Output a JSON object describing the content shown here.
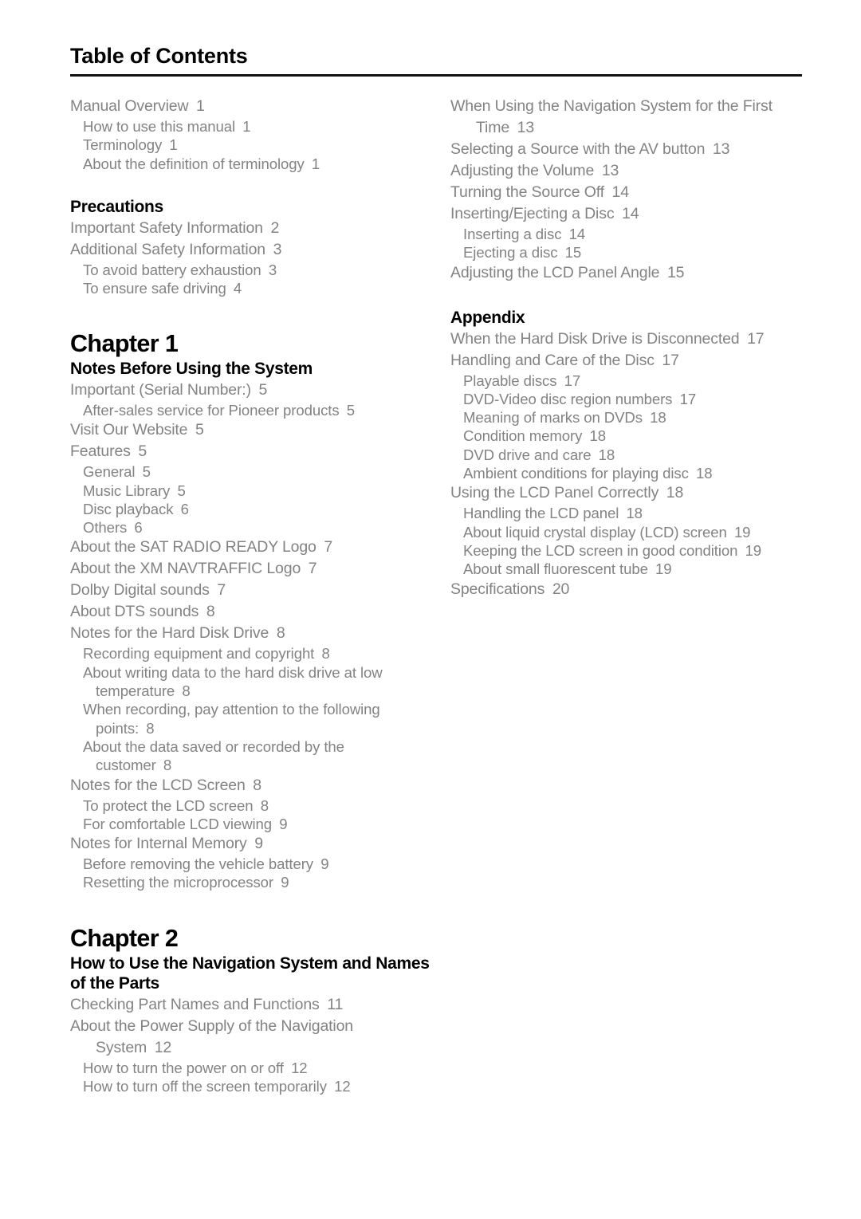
{
  "page": {
    "title": "Table of Contents"
  },
  "left_column": [
    {
      "kind": "entry",
      "level": 1,
      "text": "Manual Overview",
      "page": "1"
    },
    {
      "kind": "entry",
      "level": 2,
      "text": "How to use this manual",
      "page": "1"
    },
    {
      "kind": "entry",
      "level": 2,
      "text": "Terminology",
      "page": "1"
    },
    {
      "kind": "entry",
      "level": 2,
      "text": "About the definition of terminology",
      "page": "1"
    },
    {
      "kind": "section",
      "text": "Precautions"
    },
    {
      "kind": "entry",
      "level": 1,
      "text": "Important Safety Information",
      "page": "2"
    },
    {
      "kind": "entry",
      "level": 1,
      "text": "Additional Safety Information",
      "page": "3"
    },
    {
      "kind": "entry",
      "level": 2,
      "text": "To avoid battery exhaustion",
      "page": "3"
    },
    {
      "kind": "entry",
      "level": 2,
      "text": "To ensure safe driving",
      "page": "4"
    },
    {
      "kind": "chapter",
      "number": "Chapter  1",
      "title": "Notes Before Using the System"
    },
    {
      "kind": "entry",
      "level": 1,
      "text": "Important (Serial Number:)",
      "page": "5"
    },
    {
      "kind": "entry",
      "level": 2,
      "text": "After-sales service for Pioneer products",
      "page": "5"
    },
    {
      "kind": "entry",
      "level": 1,
      "text": "Visit Our Website",
      "page": "5"
    },
    {
      "kind": "entry",
      "level": 1,
      "text": "Features",
      "page": "5"
    },
    {
      "kind": "entry",
      "level": 2,
      "text": "General",
      "page": "5"
    },
    {
      "kind": "entry",
      "level": 2,
      "text": "Music Library",
      "page": "5"
    },
    {
      "kind": "entry",
      "level": 2,
      "text": "Disc playback",
      "page": "6"
    },
    {
      "kind": "entry",
      "level": 2,
      "text": "Others",
      "page": "6"
    },
    {
      "kind": "entry",
      "level": 1,
      "text": "About the SAT RADIO READY Logo",
      "page": "7"
    },
    {
      "kind": "entry",
      "level": 1,
      "text": "About the XM NAVTRAFFIC Logo",
      "page": "7"
    },
    {
      "kind": "entry",
      "level": 1,
      "text": "Dolby Digital sounds",
      "page": "7"
    },
    {
      "kind": "entry",
      "level": 1,
      "text": "About DTS sounds",
      "page": "8"
    },
    {
      "kind": "entry",
      "level": 1,
      "text": "Notes for the Hard Disk Drive",
      "page": "8"
    },
    {
      "kind": "entry",
      "level": 2,
      "text": "Recording equipment and copyright",
      "page": "8"
    },
    {
      "kind": "entry",
      "level": 2,
      "text": "About writing data to the hard disk drive at low",
      "wrap": "temperature",
      "page": "8"
    },
    {
      "kind": "entry",
      "level": 2,
      "text": "When recording, pay attention to the following",
      "wrap": "points:",
      "page": "8"
    },
    {
      "kind": "entry",
      "level": 2,
      "text": "About the data saved or recorded by the",
      "wrap": "customer",
      "page": "8"
    },
    {
      "kind": "entry",
      "level": 1,
      "text": "Notes for the LCD Screen",
      "page": "8"
    },
    {
      "kind": "entry",
      "level": 2,
      "text": "To protect the LCD screen",
      "page": "8"
    },
    {
      "kind": "entry",
      "level": 2,
      "text": "For comfortable LCD viewing",
      "page": "9"
    },
    {
      "kind": "entry",
      "level": 1,
      "text": "Notes for Internal Memory",
      "page": "9"
    },
    {
      "kind": "entry",
      "level": 2,
      "text": "Before removing the vehicle battery",
      "page": "9"
    },
    {
      "kind": "entry",
      "level": 2,
      "text": "Resetting the microprocessor",
      "page": "9"
    },
    {
      "kind": "chapter",
      "number": "Chapter  2",
      "title": "How to Use the Navigation System and Names of the Parts"
    },
    {
      "kind": "entry",
      "level": 1,
      "text": "Checking Part Names and Functions",
      "page": "11"
    },
    {
      "kind": "entry",
      "level": 1,
      "text": "About the Power Supply of the Navigation",
      "wrap": "System",
      "page": "12"
    },
    {
      "kind": "entry",
      "level": 2,
      "text": "How to turn the power on or off",
      "page": "12"
    },
    {
      "kind": "entry",
      "level": 2,
      "text": "How to turn off the screen temporarily",
      "page": "12"
    }
  ],
  "right_column": [
    {
      "kind": "entry",
      "level": 1,
      "text": "When Using the Navigation System for the First",
      "wrap": "Time",
      "page": "13"
    },
    {
      "kind": "entry",
      "level": 1,
      "text": "Selecting a Source with the AV button",
      "page": "13"
    },
    {
      "kind": "entry",
      "level": 1,
      "text": "Adjusting the Volume",
      "page": "13"
    },
    {
      "kind": "entry",
      "level": 1,
      "text": "Turning the Source Off",
      "page": "14"
    },
    {
      "kind": "entry",
      "level": 1,
      "text": "Inserting/Ejecting a Disc",
      "page": "14"
    },
    {
      "kind": "entry",
      "level": 2,
      "text": "Inserting a disc",
      "page": "14"
    },
    {
      "kind": "entry",
      "level": 2,
      "text": "Ejecting a disc",
      "page": "15"
    },
    {
      "kind": "entry",
      "level": 1,
      "text": "Adjusting the LCD Panel Angle",
      "page": "15"
    },
    {
      "kind": "section",
      "text": "Appendix"
    },
    {
      "kind": "entry",
      "level": 1,
      "text": "When the Hard Disk Drive is Disconnected",
      "page": "17"
    },
    {
      "kind": "entry",
      "level": 1,
      "text": "Handling and Care of the Disc",
      "page": "17"
    },
    {
      "kind": "entry",
      "level": 2,
      "text": "Playable discs",
      "page": "17"
    },
    {
      "kind": "entry",
      "level": 2,
      "text": "DVD-Video disc region numbers",
      "page": "17"
    },
    {
      "kind": "entry",
      "level": 2,
      "text": "Meaning of marks on DVDs",
      "page": "18"
    },
    {
      "kind": "entry",
      "level": 2,
      "text": "Condition memory",
      "page": "18"
    },
    {
      "kind": "entry",
      "level": 2,
      "text": "DVD drive and care",
      "page": "18"
    },
    {
      "kind": "entry",
      "level": 2,
      "text": "Ambient conditions for playing disc",
      "page": "18"
    },
    {
      "kind": "entry",
      "level": 1,
      "text": "Using the LCD Panel Correctly",
      "page": "18"
    },
    {
      "kind": "entry",
      "level": 2,
      "text": "Handling the LCD panel",
      "page": "18"
    },
    {
      "kind": "entry",
      "level": 2,
      "text": "About liquid crystal display (LCD) screen",
      "page": "19"
    },
    {
      "kind": "entry",
      "level": 2,
      "text": "Keeping the LCD screen in good condition",
      "page": "19"
    },
    {
      "kind": "entry",
      "level": 2,
      "text": "About small fluorescent tube",
      "page": "19"
    },
    {
      "kind": "entry",
      "level": 1,
      "text": "Specifications",
      "page": "20"
    }
  ]
}
